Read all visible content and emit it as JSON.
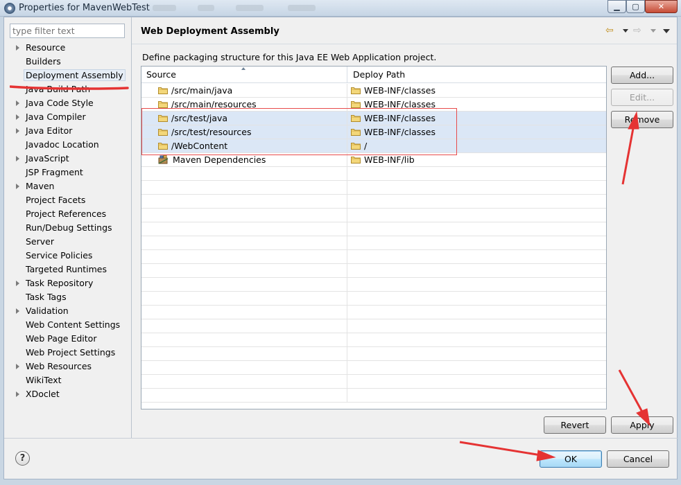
{
  "window": {
    "title": "Properties for MavenWebTest",
    "controls": {
      "minimize": "▁",
      "maximize": "▢",
      "close": "✕"
    }
  },
  "filter": {
    "placeholder": "type filter text"
  },
  "nav": {
    "items": [
      {
        "label": "Resource",
        "expandable": true
      },
      {
        "label": "Builders",
        "expandable": false
      },
      {
        "label": "Deployment Assembly",
        "expandable": false,
        "selected": true
      },
      {
        "label": "Java Build Path",
        "expandable": false
      },
      {
        "label": "Java Code Style",
        "expandable": true
      },
      {
        "label": "Java Compiler",
        "expandable": true
      },
      {
        "label": "Java Editor",
        "expandable": true
      },
      {
        "label": "Javadoc Location",
        "expandable": false
      },
      {
        "label": "JavaScript",
        "expandable": true
      },
      {
        "label": "JSP Fragment",
        "expandable": false
      },
      {
        "label": "Maven",
        "expandable": true
      },
      {
        "label": "Project Facets",
        "expandable": false
      },
      {
        "label": "Project References",
        "expandable": false
      },
      {
        "label": "Run/Debug Settings",
        "expandable": false
      },
      {
        "label": "Server",
        "expandable": false
      },
      {
        "label": "Service Policies",
        "expandable": false
      },
      {
        "label": "Targeted Runtimes",
        "expandable": false
      },
      {
        "label": "Task Repository",
        "expandable": true
      },
      {
        "label": "Task Tags",
        "expandable": false
      },
      {
        "label": "Validation",
        "expandable": true
      },
      {
        "label": "Web Content Settings",
        "expandable": false
      },
      {
        "label": "Web Page Editor",
        "expandable": false
      },
      {
        "label": "Web Project Settings",
        "expandable": false
      },
      {
        "label": "Web Resources",
        "expandable": true
      },
      {
        "label": "WikiText",
        "expandable": false
      },
      {
        "label": "XDoclet",
        "expandable": true
      }
    ]
  },
  "page": {
    "title": "Web Deployment Assembly",
    "description": "Define packaging structure for this Java EE Web Application project."
  },
  "table": {
    "columns": {
      "source": "Source",
      "deploy_path": "Deploy Path"
    },
    "rows": [
      {
        "source": "/src/main/java",
        "deploy": "WEB-INF/classes",
        "icon": "folder-icon",
        "selected": false
      },
      {
        "source": "/src/main/resources",
        "deploy": "WEB-INF/classes",
        "icon": "folder-icon",
        "selected": false
      },
      {
        "source": "/src/test/java",
        "deploy": "WEB-INF/classes",
        "icon": "folder-icon",
        "selected": true
      },
      {
        "source": "/src/test/resources",
        "deploy": "WEB-INF/classes",
        "icon": "folder-icon",
        "selected": true
      },
      {
        "source": "/WebContent",
        "deploy": "/",
        "icon": "folder-icon",
        "selected": true
      },
      {
        "source": "Maven Dependencies",
        "deploy": "WEB-INF/lib",
        "icon": "library-icon",
        "selected": false
      }
    ]
  },
  "buttons": {
    "add": "Add...",
    "edit": "Edit...",
    "remove": "Remove",
    "revert": "Revert",
    "apply": "Apply",
    "ok": "OK",
    "cancel": "Cancel",
    "help": "?"
  },
  "colors": {
    "annotation": "#e53333",
    "selection": "#dbe7f6",
    "folder": "#e8c25a"
  }
}
